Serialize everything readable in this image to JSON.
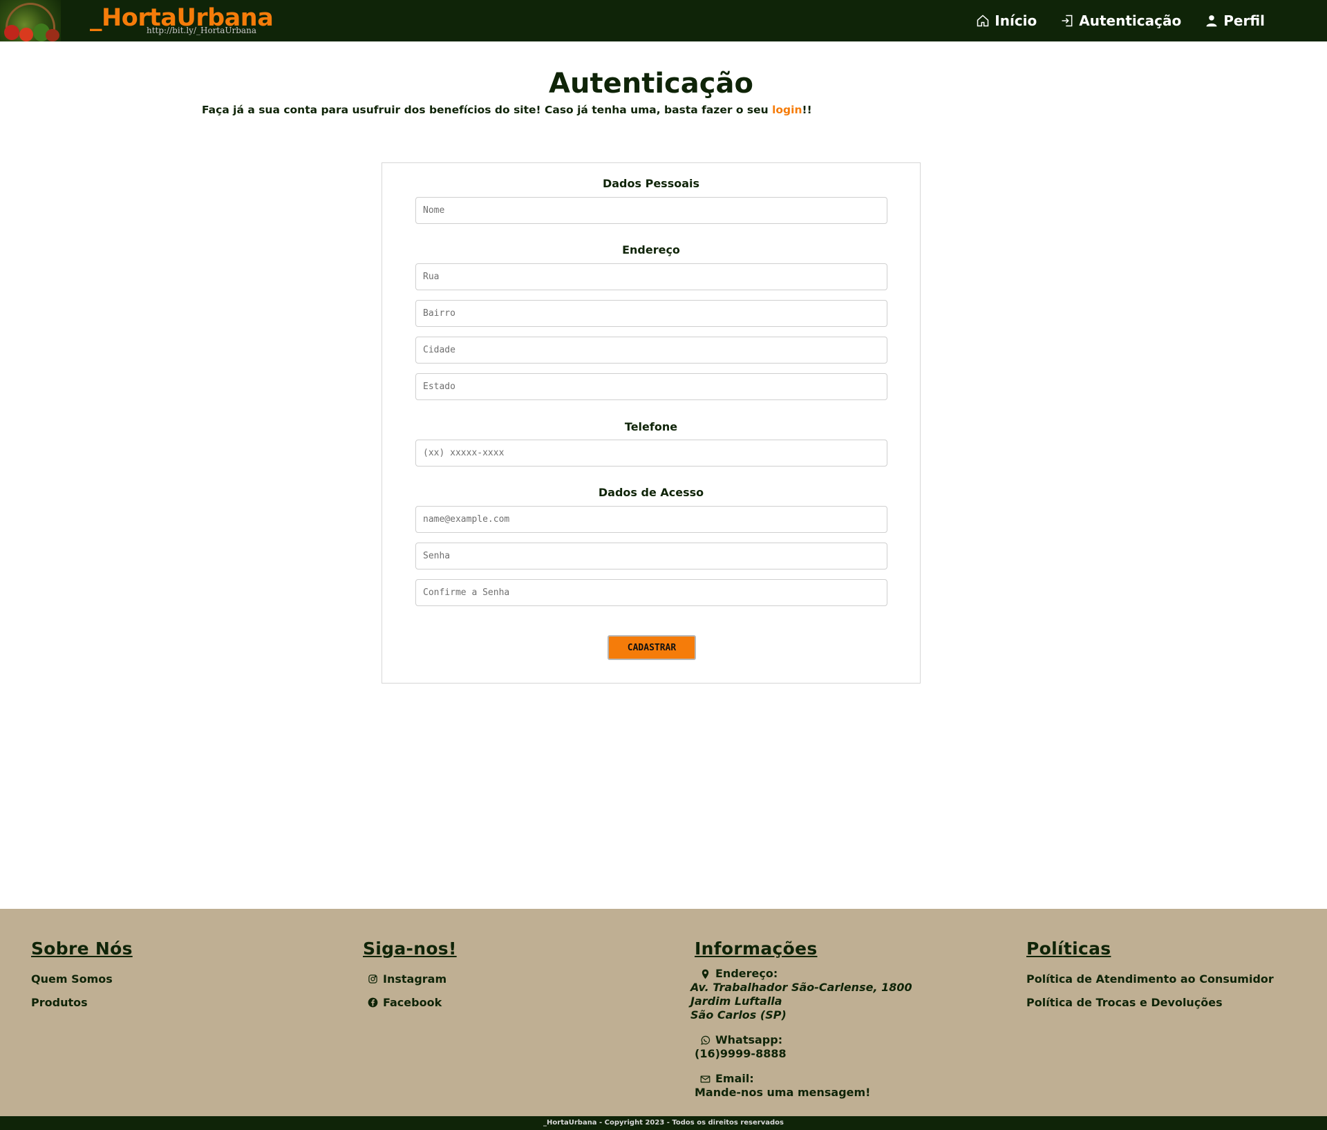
{
  "header": {
    "brand": "_HortaUrbana",
    "brand_url": "http://bit.ly/_HortaUrbana",
    "nav": [
      {
        "label": "Início",
        "icon": "home-icon"
      },
      {
        "label": "Autenticação",
        "icon": "login-icon"
      },
      {
        "label": "Perfil",
        "icon": "user-icon"
      }
    ]
  },
  "main": {
    "title": "Autenticação",
    "intro_text": "Faça já a sua conta para usufruir dos benefícios do site! Caso já tenha uma, basta fazer o seu ",
    "intro_link": "login",
    "intro_end": "!!"
  },
  "form": {
    "personal_title": "Dados Pessoais",
    "name_placeholder": "Nome",
    "address_title": "Endereço",
    "street_placeholder": "Rua",
    "district_placeholder": "Bairro",
    "city_placeholder": "Cidade",
    "state_placeholder": "Estado",
    "phone_title": "Telefone",
    "phone_placeholder": "(xx) xxxxx-xxxx",
    "access_title": "Dados de Acesso",
    "email_placeholder": "name@example.com",
    "password_placeholder": "Senha",
    "confirm_placeholder": "Confirme a Senha",
    "submit_label": "CADASTRAR"
  },
  "footer": {
    "about": {
      "title": "Sobre Nós",
      "links": [
        "Quem Somos",
        "Produtos"
      ]
    },
    "follow": {
      "title": "Siga-nos!",
      "links": [
        {
          "label": "Instagram",
          "icon": "instagram-icon"
        },
        {
          "label": "Facebook",
          "icon": "facebook-icon"
        }
      ]
    },
    "info": {
      "title": "Informações",
      "address_label": "Endereço:",
      "address_lines": [
        "Av. Trabalhador São-Carlense, 1800",
        "Jardim Luftalla",
        "São Carlos (SP)"
      ],
      "whatsapp_label": "Whatsapp:",
      "whatsapp_value": "(16)9999-8888",
      "email_label": "Email:",
      "email_value": "Mande-nos uma mensagem!"
    },
    "policies": {
      "title": "Políticas",
      "links": [
        "Política de Atendimento ao Consumidor",
        "Política de Trocas e Devoluções"
      ]
    },
    "copyright": "_HortaUrbana - Copyright 2023 - Todos os direitos reservados"
  },
  "colors": {
    "dark_green": "#0f2408",
    "orange": "#f57c0a",
    "footer_bg": "#bfaf93"
  }
}
